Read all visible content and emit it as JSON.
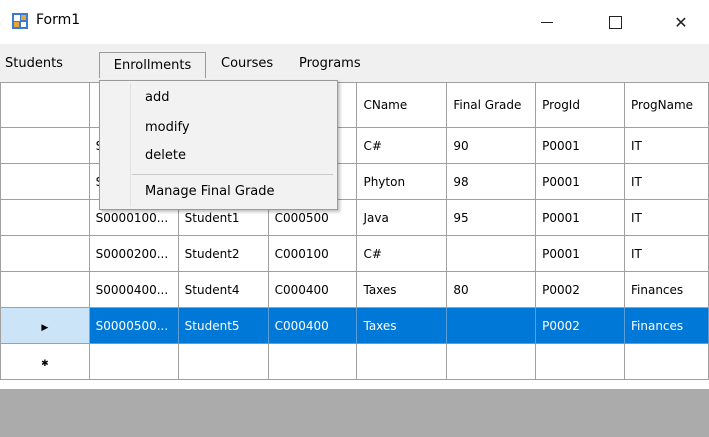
{
  "window": {
    "title": "Form1"
  },
  "menu": [
    "Students",
    "Enrollments",
    "Courses",
    "Programs"
  ],
  "dropdown": {
    "items": [
      "add",
      "modify",
      "delete"
    ],
    "manage": "Manage Final Grade"
  },
  "grid": {
    "columns": [
      "",
      "",
      "CName",
      "Final Grade",
      "ProgId",
      "ProgName"
    ],
    "rows": [
      {
        "c": [
          "S",
          "",
          "",
          "C#",
          "90",
          "P0001",
          "IT"
        ]
      },
      {
        "c": [
          "S",
          "",
          "",
          "Phyton",
          "98",
          "P0001",
          "IT"
        ]
      },
      {
        "c": [
          "S0000100...",
          "Student1",
          "C000500",
          "Java",
          "95",
          "P0001",
          "IT"
        ]
      },
      {
        "c": [
          "S0000200...",
          "Student2",
          "C000100",
          "C#",
          "",
          "P0001",
          "IT"
        ]
      },
      {
        "c": [
          "S0000400...",
          "Student4",
          "C000400",
          "Taxes",
          "80",
          "P0002",
          "Finances"
        ]
      },
      {
        "c": [
          "S0000500...",
          "Student5",
          "C000400",
          "Taxes",
          "",
          "P0002",
          "Finances"
        ],
        "selected": true
      }
    ],
    "current_row_glyph": "▶",
    "new_row_glyph": "✱"
  },
  "colors": {
    "selection": "#0078d7",
    "menu_bg": "#f0f0f0",
    "bottom_area": "#ababab"
  }
}
